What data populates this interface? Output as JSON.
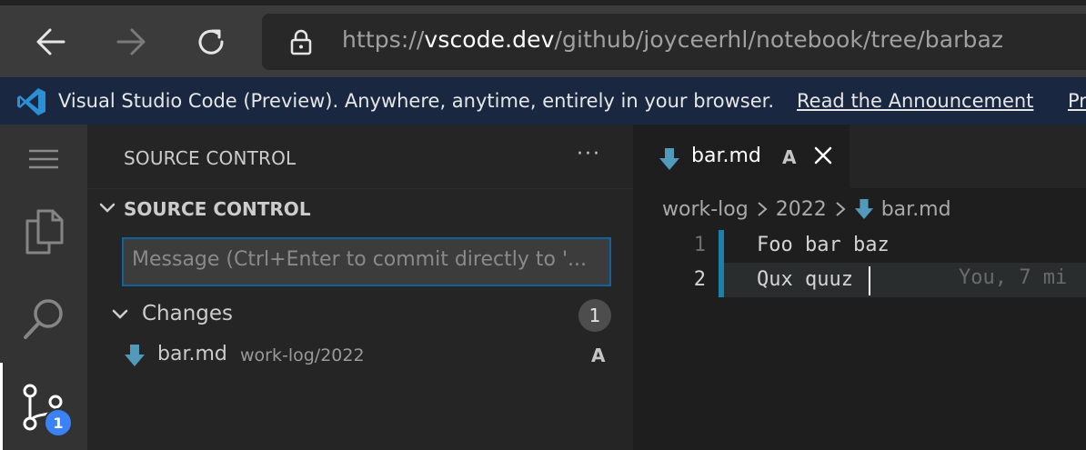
{
  "browser": {
    "url_prefix": "https://",
    "url_host": "vscode.dev",
    "url_path": "/github/joyceerhl/notebook/tree/barbaz"
  },
  "banner": {
    "message": "Visual Studio Code (Preview). Anywhere, anytime, entirely in your browser.",
    "link": "Read the Announcement",
    "link2": "Pr"
  },
  "activity_bar": {
    "source_control_badge": "1"
  },
  "sidebar": {
    "title": "SOURCE CONTROL",
    "more": "···",
    "section_label": "SOURCE CONTROL",
    "commit_placeholder": "Message (Ctrl+Enter to commit directly to '...",
    "changes_label": "Changes",
    "changes_count": "1",
    "files": [
      {
        "name": "bar.md",
        "path": "work-log/2022",
        "status": "A"
      }
    ]
  },
  "editor": {
    "tab": {
      "name": "bar.md",
      "status": "A"
    },
    "breadcrumb": [
      "work-log",
      "2022",
      "bar.md"
    ],
    "lines": [
      {
        "number": "1",
        "text": "Foo bar baz"
      },
      {
        "number": "2",
        "text": "Qux quuz"
      }
    ],
    "blame": "You, 7 mi"
  },
  "colors": {
    "accent": "#0e639c",
    "badge": "#3b82f6",
    "markdown_icon": "#519aba",
    "diff_added": "#1b81a8"
  }
}
